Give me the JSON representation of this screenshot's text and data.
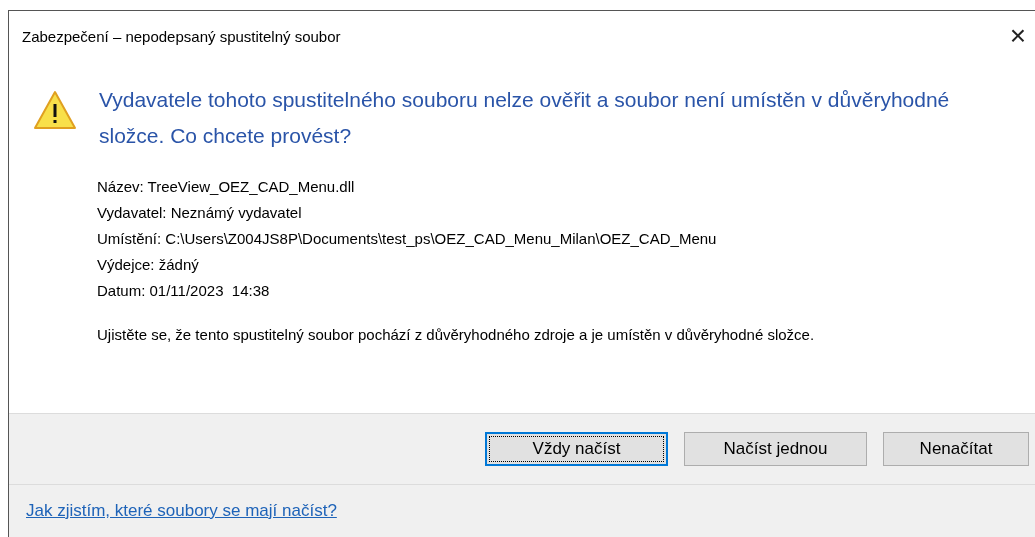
{
  "window": {
    "title": "Zabezpečení – nepodepsaný spustitelný soubor",
    "close": "×"
  },
  "heading": "Vydavatele tohoto spustitelného souboru nelze ověřit a soubor není umístěn v důvěryhodné složce. Co chcete provést?",
  "details": [
    "Název: TreeView_OEZ_CAD_Menu.dll",
    "Vydavatel: Neznámý vydavatel",
    "Umístění: C:\\Users\\Z004JS8P\\Documents\\test_ps\\OEZ_CAD_Menu_Milan\\OEZ_CAD_Menu",
    "Výdejce: žádný",
    "Datum: 01/11/2023  14:38"
  ],
  "message": "Ujistěte se, že tento spustitelný soubor pochází z důvěryhodného zdroje a je umístěn v důvěryhodné složce.",
  "buttons": [
    {
      "label": "Vždy načíst",
      "selected": true
    },
    {
      "label": "Načíst jednou",
      "selected": false
    },
    {
      "label": "Nenačítat",
      "selected": false
    }
  ],
  "help_link": "Jak zjistím, které soubory se mají načíst?"
}
